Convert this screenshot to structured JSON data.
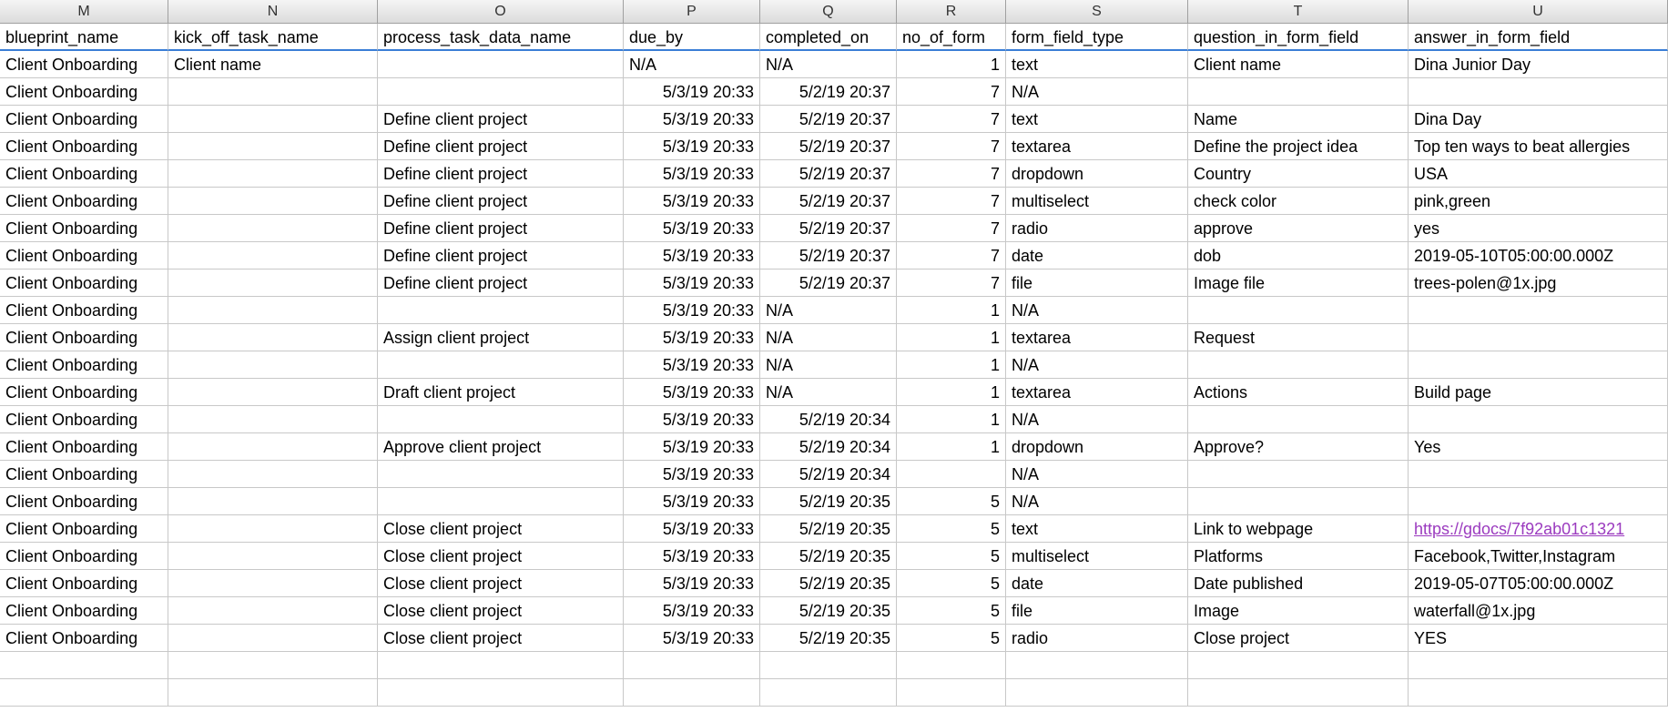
{
  "columns": [
    "M",
    "N",
    "O",
    "P",
    "Q",
    "R",
    "S",
    "T",
    "U"
  ],
  "headers": {
    "M": "blueprint_name",
    "N": "kick_off_task_name",
    "O": "process_task_data_name",
    "P": "due_by",
    "Q": "completed_on",
    "R": "no_of_form",
    "S": "form_field_type",
    "T": "question_in_form_field",
    "U": "answer_in_form_field"
  },
  "rows": [
    {
      "M": "Client Onboarding",
      "N": "Client name",
      "O": "",
      "P": "N/A",
      "Q": "N/A",
      "R": "1",
      "S": "text",
      "T": "Client name",
      "U": "Dina Junior Day"
    },
    {
      "M": "Client Onboarding",
      "N": "",
      "O": "",
      "P": "5/3/19 20:33",
      "Q": "5/2/19 20:37",
      "R": "7",
      "S": "N/A",
      "T": "",
      "U": ""
    },
    {
      "M": "Client Onboarding",
      "N": "",
      "O": "Define client project",
      "P": "5/3/19 20:33",
      "Q": "5/2/19 20:37",
      "R": "7",
      "S": "text",
      "T": "Name",
      "U": "Dina Day"
    },
    {
      "M": "Client Onboarding",
      "N": "",
      "O": "Define client project",
      "P": "5/3/19 20:33",
      "Q": "5/2/19 20:37",
      "R": "7",
      "S": "textarea",
      "T": "Define the project idea",
      "U": "Top ten ways to beat allergies"
    },
    {
      "M": "Client Onboarding",
      "N": "",
      "O": "Define client project",
      "P": "5/3/19 20:33",
      "Q": "5/2/19 20:37",
      "R": "7",
      "S": "dropdown",
      "T": "Country",
      "U": "USA"
    },
    {
      "M": "Client Onboarding",
      "N": "",
      "O": "Define client project",
      "P": "5/3/19 20:33",
      "Q": "5/2/19 20:37",
      "R": "7",
      "S": "multiselect",
      "T": "check color",
      "U": "pink,green"
    },
    {
      "M": "Client Onboarding",
      "N": "",
      "O": "Define client project",
      "P": "5/3/19 20:33",
      "Q": "5/2/19 20:37",
      "R": "7",
      "S": "radio",
      "T": "approve",
      "U": "yes"
    },
    {
      "M": "Client Onboarding",
      "N": "",
      "O": "Define client project",
      "P": "5/3/19 20:33",
      "Q": "5/2/19 20:37",
      "R": "7",
      "S": "date",
      "T": "dob",
      "U": "2019-05-10T05:00:00.000Z"
    },
    {
      "M": "Client Onboarding",
      "N": "",
      "O": "Define client project",
      "P": "5/3/19 20:33",
      "Q": "5/2/19 20:37",
      "R": "7",
      "S": "file",
      "T": "Image file",
      "U": "trees-polen@1x.jpg"
    },
    {
      "M": "Client Onboarding",
      "N": "",
      "O": "",
      "P": "5/3/19 20:33",
      "Q": "N/A",
      "R": "1",
      "S": "N/A",
      "T": "",
      "U": ""
    },
    {
      "M": "Client Onboarding",
      "N": "",
      "O": "Assign client project",
      "P": "5/3/19 20:33",
      "Q": "N/A",
      "R": "1",
      "S": "textarea",
      "T": "Request",
      "U": ""
    },
    {
      "M": "Client Onboarding",
      "N": "",
      "O": "",
      "P": "5/3/19 20:33",
      "Q": "N/A",
      "R": "1",
      "S": "N/A",
      "T": "",
      "U": ""
    },
    {
      "M": "Client Onboarding",
      "N": "",
      "O": "Draft client project",
      "P": "5/3/19 20:33",
      "Q": "N/A",
      "R": "1",
      "S": "textarea",
      "T": "Actions",
      "U": "Build page"
    },
    {
      "M": "Client Onboarding",
      "N": "",
      "O": "",
      "P": "5/3/19 20:33",
      "Q": "5/2/19 20:34",
      "R": "1",
      "S": "N/A",
      "T": "",
      "U": ""
    },
    {
      "M": "Client Onboarding",
      "N": "",
      "O": "Approve client project",
      "P": "5/3/19 20:33",
      "Q": "5/2/19 20:34",
      "R": "1",
      "S": "dropdown",
      "T": "Approve?",
      "U": "Yes"
    },
    {
      "M": "Client Onboarding",
      "N": "",
      "O": "",
      "P": "5/3/19 20:33",
      "Q": "5/2/19 20:34",
      "R": "",
      "S": "N/A",
      "T": "",
      "U": ""
    },
    {
      "M": "Client Onboarding",
      "N": "",
      "O": "",
      "P": "5/3/19 20:33",
      "Q": "5/2/19 20:35",
      "R": "5",
      "S": "N/A",
      "T": "",
      "U": ""
    },
    {
      "M": "Client Onboarding",
      "N": "",
      "O": "Close client project",
      "P": "5/3/19 20:33",
      "Q": "5/2/19 20:35",
      "R": "5",
      "S": "text",
      "T": "Link to webpage",
      "U": "https://gdocs/7f92ab01c1321",
      "U_link": true
    },
    {
      "M": "Client Onboarding",
      "N": "",
      "O": "Close client project",
      "P": "5/3/19 20:33",
      "Q": "5/2/19 20:35",
      "R": "5",
      "S": "multiselect",
      "T": "Platforms",
      "U": "Facebook,Twitter,Instagram"
    },
    {
      "M": "Client Onboarding",
      "N": "",
      "O": "Close client project",
      "P": "5/3/19 20:33",
      "Q": "5/2/19 20:35",
      "R": "5",
      "S": "date",
      "T": "Date published",
      "U": "2019-05-07T05:00:00.000Z"
    },
    {
      "M": "Client Onboarding",
      "N": "",
      "O": "Close client project",
      "P": "5/3/19 20:33",
      "Q": "5/2/19 20:35",
      "R": "5",
      "S": "file",
      "T": "Image",
      "U": "waterfall@1x.jpg"
    },
    {
      "M": "Client Onboarding",
      "N": "",
      "O": "Close client project",
      "P": "5/3/19 20:33",
      "Q": "5/2/19 20:35",
      "R": "5",
      "S": "radio",
      "T": "Close project",
      "U": "YES"
    },
    {
      "M": "",
      "N": "",
      "O": "",
      "P": "",
      "Q": "",
      "R": "",
      "S": "",
      "T": "",
      "U": ""
    },
    {
      "M": "",
      "N": "",
      "O": "",
      "P": "",
      "Q": "",
      "R": "",
      "S": "",
      "T": "",
      "U": ""
    }
  ],
  "align": {
    "P": "date",
    "Q": "date",
    "R": "num"
  }
}
